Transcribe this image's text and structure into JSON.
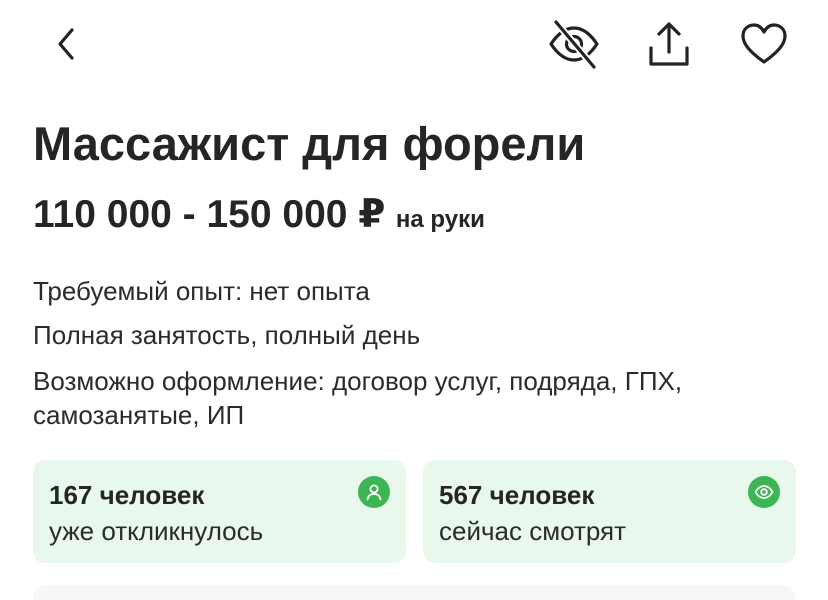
{
  "header": {
    "back_icon": "chevron-left-icon",
    "hide_icon": "eye-off-icon",
    "share_icon": "share-upload-icon",
    "favorite_icon": "heart-icon"
  },
  "vacancy": {
    "title": "Массажист для форели",
    "salary": "110 000 - 150 000 ₽",
    "salary_note": "на руки",
    "experience": "Требуемый опыт: нет опыта",
    "employment": "Полная занятость, полный день",
    "contract": "Возможно оформление: договор услуг, подряда, ГПХ, самозанятые, ИП"
  },
  "stats": {
    "responses": {
      "count": "167 человек",
      "caption": "уже откликнулось",
      "icon": "person-icon"
    },
    "viewing": {
      "count": "567 человек",
      "caption": "сейчас смотрят",
      "icon": "eye-icon"
    }
  },
  "colors": {
    "card_bg": "#e9f8ec",
    "accent_green": "#3cb554",
    "text": "#252525"
  }
}
